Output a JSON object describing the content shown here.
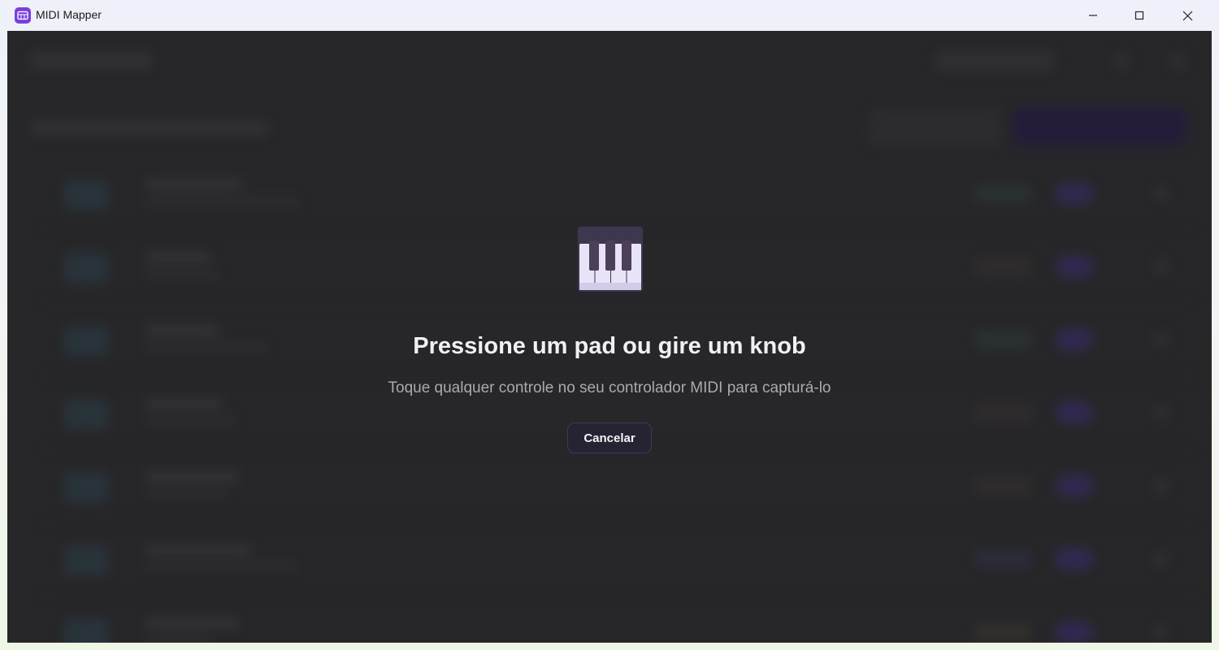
{
  "window": {
    "title": "MIDI Mapper",
    "app_icon": "midi-keyboard-icon",
    "controls": [
      "minimize-icon",
      "maximize-icon",
      "close-icon"
    ]
  },
  "capture_dialog": {
    "icon": "piano-keys-icon",
    "title": "Pressione um pad ou gire um knob",
    "subtitle": "Toque qualquer controle no seu controlador MIDI para capturá-lo",
    "cancel_label": "Cancelar"
  },
  "colors": {
    "app_background": "#2e2e30",
    "accent": "#7a3fe0",
    "dialog_title": "#f1f1f3",
    "dialog_subtitle": "#a9a9b0",
    "cancel_button_bg": "#262433"
  }
}
